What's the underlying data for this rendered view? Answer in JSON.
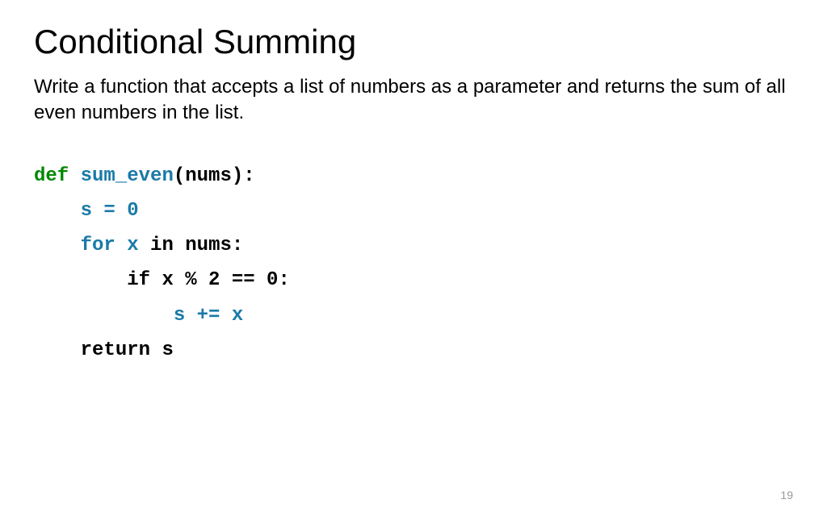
{
  "slide": {
    "title": "Conditional Summing",
    "description": "Write a function that accepts a list of numbers as a parameter and returns the sum of all even numbers in the list.",
    "page_number": "19"
  },
  "code": {
    "line1": {
      "def": "def",
      "sp1": " ",
      "fname": "sum_even",
      "paren_open": "(",
      "param": "nums",
      "paren_close": ")",
      "colon": ":"
    },
    "line2": {
      "indent": "    ",
      "stmt": "s = 0"
    },
    "line3": {
      "indent": "    ",
      "for_kw": "for",
      "sp1": " ",
      "var": "x",
      "sp2": " ",
      "in_kw": "in",
      "sp3": " ",
      "iter": "nums",
      "colon": ":"
    },
    "line4": {
      "indent": "        ",
      "if_kw": "if",
      "sp1": " ",
      "cond": "x % 2 == 0",
      "colon": ":"
    },
    "line5": {
      "indent": "            ",
      "stmt": "s += x"
    },
    "line6": {
      "indent": "    ",
      "return_kw": "return",
      "sp1": " ",
      "val": "s"
    }
  }
}
